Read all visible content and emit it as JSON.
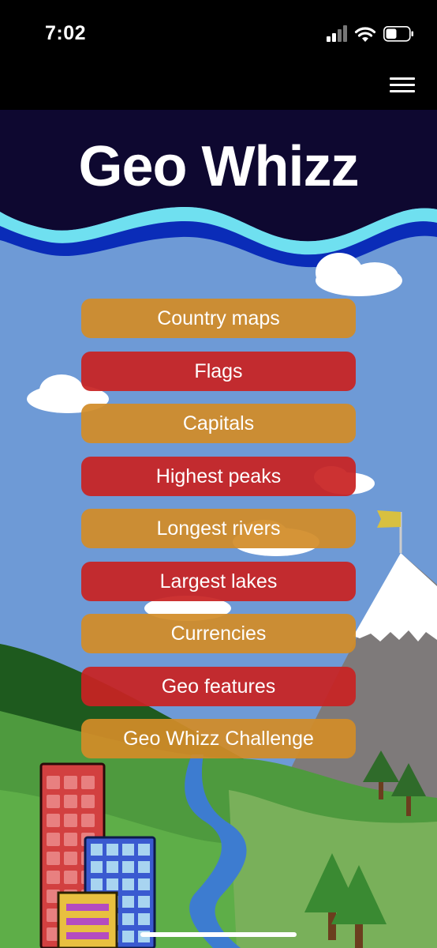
{
  "status": {
    "time": "7:02",
    "icons": [
      "signal-icon",
      "wifi-icon",
      "battery-icon"
    ]
  },
  "header": {
    "menu_icon": "hamburger-menu-icon",
    "title": "Geo Whizz"
  },
  "menu": {
    "items": [
      {
        "label": "Country maps",
        "color": "#D28C28"
      },
      {
        "label": "Flags",
        "color": "#C82222"
      },
      {
        "label": "Capitals",
        "color": "#D28C28"
      },
      {
        "label": "Highest peaks",
        "color": "#C82222"
      },
      {
        "label": "Longest rivers",
        "color": "#D28C28"
      },
      {
        "label": "Largest lakes",
        "color": "#C82222"
      },
      {
        "label": "Currencies",
        "color": "#D28C28"
      },
      {
        "label": "Geo features",
        "color": "#C82222"
      },
      {
        "label": "Geo Whizz Challenge",
        "color": "#D28C28"
      }
    ]
  },
  "colors": {
    "sky": "#6E9AD6",
    "header_band": "#0E0830",
    "wave_dark": "#0A2CB8",
    "wave_light": "#6FE0F0",
    "hill_green": "#4E9A3E",
    "forest_dark": "#1E5A1E",
    "mountain": "#7E7A7A",
    "river": "#3D7CD0"
  }
}
